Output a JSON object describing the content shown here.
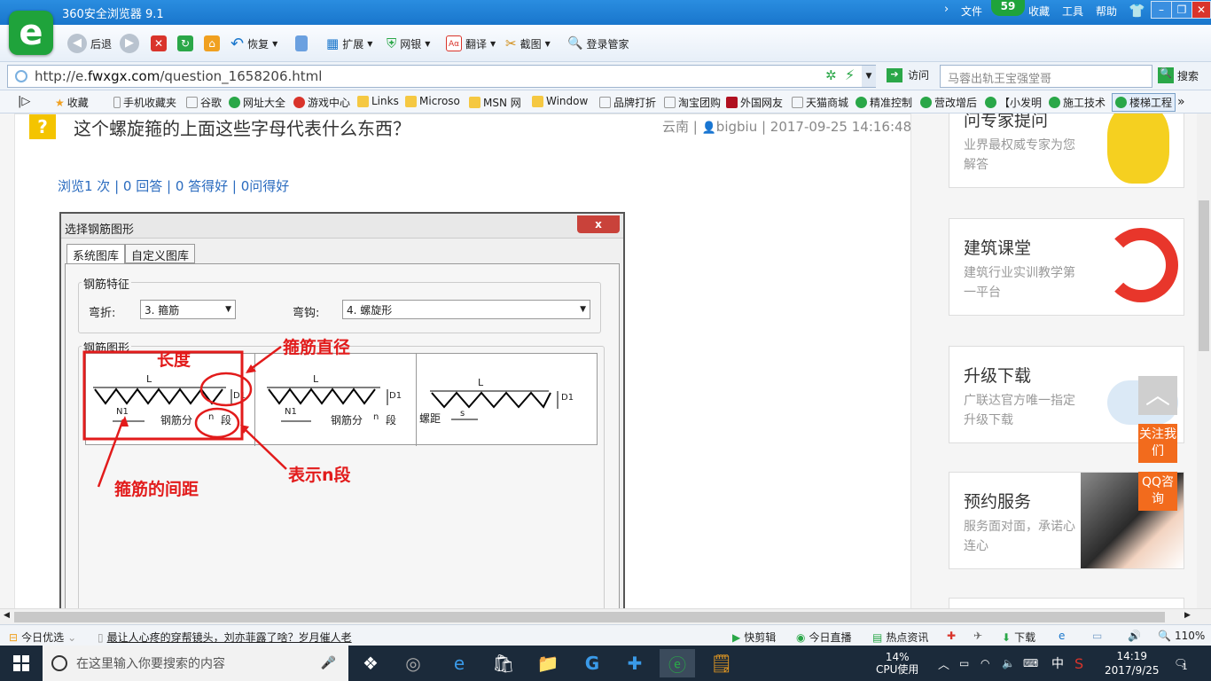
{
  "window": {
    "title": "360安全浏览器 9.1",
    "menu": [
      "文件",
      "收藏",
      "工具",
      "帮助"
    ],
    "badge": "59"
  },
  "toolbar": {
    "back": "后退",
    "restore": "恢复",
    "extend": "扩展",
    "bank": "网银",
    "translate": "翻译",
    "screenshot": "截图",
    "login": "登录管家"
  },
  "address": {
    "url_prefix": "http://e.",
    "url_domain": "fwxgx.com",
    "url_path": "/question_1658206.html",
    "visit": "访问",
    "search_value": "马蓉出轨王宝强堂哥",
    "search_label": "搜索"
  },
  "favorites": [
    "收藏",
    "手机收藏夹",
    "谷歌",
    "网址大全",
    "游戏中心",
    "Links",
    "Microso",
    "MSN 网",
    "Window",
    "品牌打折",
    "淘宝团购",
    "外国网友",
    "天猫商城",
    "精准控制",
    "营改增后",
    "【小发明",
    "施工技术",
    "楼梯工程"
  ],
  "question": {
    "icon": "?",
    "title": "这个螺旋箍的上面这些字母代表什么东西？",
    "meta_region": "云南",
    "meta_user": "bigbiu",
    "meta_time": "2017-09-25 14:16:48",
    "stats": [
      "浏览1 次",
      "0 回答",
      "0 答得好",
      "0问得好"
    ]
  },
  "dialog": {
    "title": "选择钢筋图形",
    "close": "x",
    "tabs": [
      "系统图库",
      "自定义图库"
    ],
    "feature_group": "钢筋特征",
    "bend_label": "弯折:",
    "bend_value": "3. 箍筋",
    "hook_label": "弯钩:",
    "hook_value": "4. 螺旋形",
    "shape_group": "钢筋图形",
    "shape1": {
      "L": "L",
      "D1": "D1",
      "N1": "N1",
      "seg": "钢筋分",
      "n": "n",
      "duan": "段"
    },
    "shape2": {
      "L": "L",
      "D1": "D1",
      "N1": "N1",
      "seg": "钢筋分",
      "n": "n",
      "duan": "段"
    },
    "shape3": {
      "L": "L",
      "D1": "D1",
      "pitch": "螺距",
      "s": "s"
    }
  },
  "annotations": {
    "length": "长度",
    "diameter": "箍筋直径",
    "spacing": "箍筋的间距",
    "nseg": "表示n段"
  },
  "sidebar": [
    {
      "title": "问专家提问",
      "desc": "业界最权威专家为您解答"
    },
    {
      "title": "建筑课堂",
      "desc": "建筑行业实训教学第一平台"
    },
    {
      "title": "升级下载",
      "desc": "广联达官方唯一指定升级下载"
    },
    {
      "title": "预约服务",
      "desc": "服务面对面，承诺心连心"
    }
  ],
  "float": {
    "top": "︿",
    "follow": "关注我们",
    "qq": "QQ咨询"
  },
  "status": {
    "daily": "今日优选",
    "news": "最让人心疼的穿帮镜头，刘亦菲露了啥？岁月催人老",
    "clip": "快剪辑",
    "live": "今日直播",
    "hot": "热点资讯",
    "download": "下载",
    "zoom": "110%"
  },
  "taskbar": {
    "search_placeholder": "在这里输入你要搜索的内容",
    "cpu_pct": "14%",
    "cpu_label": "CPU使用",
    "ime": "中",
    "time": "14:19",
    "date": "2017/9/25",
    "notif": "1"
  },
  "colors": {
    "accent": "#1976cc",
    "annotation": "#e21b1b",
    "orange": "#f26b1d"
  }
}
